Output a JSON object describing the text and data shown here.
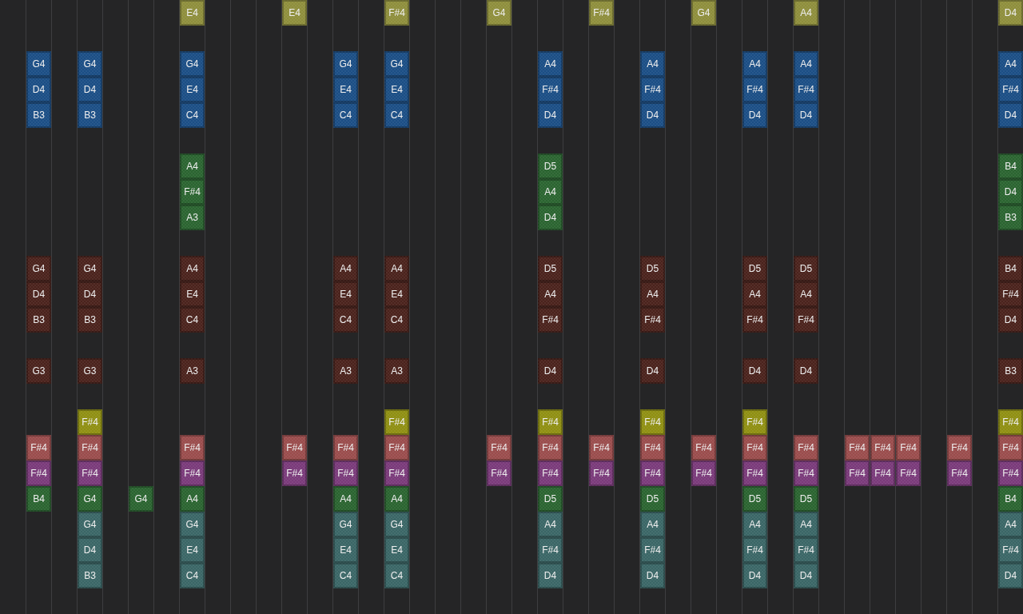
{
  "lanes": [
    {
      "color": "#8e8e3c",
      "cells": [
        null,
        null,
        null,
        null,
        null,
        null,
        null,
        "E4",
        null,
        null,
        null,
        "E4",
        null,
        null,
        null,
        "F#4",
        null,
        null,
        null,
        "G4",
        null,
        null,
        null,
        "F#4",
        null,
        null,
        null,
        "G4",
        null,
        null,
        null,
        "A4",
        null,
        null,
        null,
        null,
        null,
        null,
        null,
        "D4"
      ]
    },
    {
      "kind": "gap"
    },
    {
      "color": "#1b4e85",
      "cells": [
        null,
        "G4",
        null,
        "G4",
        null,
        null,
        null,
        "G4",
        null,
        null,
        null,
        null,
        null,
        "G4",
        null,
        "G4",
        null,
        null,
        null,
        null,
        null,
        "A4",
        null,
        null,
        null,
        "A4",
        null,
        null,
        null,
        "A4",
        null,
        "A4",
        null,
        null,
        null,
        null,
        null,
        null,
        null,
        "A4"
      ]
    },
    {
      "color": "#1b4e85",
      "cells": [
        null,
        "D4",
        null,
        "D4",
        null,
        null,
        null,
        "E4",
        null,
        null,
        null,
        null,
        null,
        "E4",
        null,
        "E4",
        null,
        null,
        null,
        null,
        null,
        "F#4",
        null,
        null,
        null,
        "F#4",
        null,
        null,
        null,
        "F#4",
        null,
        "F#4",
        null,
        null,
        null,
        null,
        null,
        null,
        null,
        "F#4"
      ]
    },
    {
      "color": "#1b4e85",
      "cells": [
        null,
        "B3",
        null,
        "B3",
        null,
        null,
        null,
        "C4",
        null,
        null,
        null,
        null,
        null,
        "C4",
        null,
        "C4",
        null,
        null,
        null,
        null,
        null,
        "D4",
        null,
        null,
        null,
        "D4",
        null,
        null,
        null,
        "D4",
        null,
        "D4",
        null,
        null,
        null,
        null,
        null,
        null,
        null,
        "D4"
      ]
    },
    {
      "kind": "gap"
    },
    {
      "color": "#2a6430",
      "cells": [
        null,
        null,
        null,
        null,
        null,
        null,
        null,
        "A4",
        null,
        null,
        null,
        null,
        null,
        null,
        null,
        null,
        null,
        null,
        null,
        null,
        null,
        "D5",
        null,
        null,
        null,
        null,
        null,
        null,
        null,
        null,
        null,
        null,
        null,
        null,
        null,
        null,
        null,
        null,
        null,
        "B4"
      ]
    },
    {
      "color": "#2a6430",
      "cells": [
        null,
        null,
        null,
        null,
        null,
        null,
        null,
        "F#4",
        null,
        null,
        null,
        null,
        null,
        null,
        null,
        null,
        null,
        null,
        null,
        null,
        null,
        "A4",
        null,
        null,
        null,
        null,
        null,
        null,
        null,
        null,
        null,
        null,
        null,
        null,
        null,
        null,
        null,
        null,
        null,
        "D4"
      ]
    },
    {
      "color": "#2a6430",
      "cells": [
        null,
        null,
        null,
        null,
        null,
        null,
        null,
        "A3",
        null,
        null,
        null,
        null,
        null,
        null,
        null,
        null,
        null,
        null,
        null,
        null,
        null,
        "D4",
        null,
        null,
        null,
        null,
        null,
        null,
        null,
        null,
        null,
        null,
        null,
        null,
        null,
        null,
        null,
        null,
        null,
        "B3"
      ]
    },
    {
      "kind": "gap"
    },
    {
      "color": "#4a221c",
      "cells": [
        null,
        "G4",
        null,
        "G4",
        null,
        null,
        null,
        "A4",
        null,
        null,
        null,
        null,
        null,
        "A4",
        null,
        "A4",
        null,
        null,
        null,
        null,
        null,
        "D5",
        null,
        null,
        null,
        "D5",
        null,
        null,
        null,
        "D5",
        null,
        "D5",
        null,
        null,
        null,
        null,
        null,
        null,
        null,
        "B4"
      ]
    },
    {
      "color": "#4a221c",
      "cells": [
        null,
        "D4",
        null,
        "D4",
        null,
        null,
        null,
        "E4",
        null,
        null,
        null,
        null,
        null,
        "E4",
        null,
        "E4",
        null,
        null,
        null,
        null,
        null,
        "A4",
        null,
        null,
        null,
        "A4",
        null,
        null,
        null,
        "A4",
        null,
        "A4",
        null,
        null,
        null,
        null,
        null,
        null,
        null,
        "F#4"
      ]
    },
    {
      "color": "#4a221c",
      "cells": [
        null,
        "B3",
        null,
        "B3",
        null,
        null,
        null,
        "C4",
        null,
        null,
        null,
        null,
        null,
        "C4",
        null,
        "C4",
        null,
        null,
        null,
        null,
        null,
        "F#4",
        null,
        null,
        null,
        "F#4",
        null,
        null,
        null,
        "F#4",
        null,
        "F#4",
        null,
        null,
        null,
        null,
        null,
        null,
        null,
        "D4"
      ]
    },
    {
      "kind": "gap"
    },
    {
      "color": "#4a221c",
      "cells": [
        null,
        "G3",
        null,
        "G3",
        null,
        null,
        null,
        "A3",
        null,
        null,
        null,
        null,
        null,
        "A3",
        null,
        "A3",
        null,
        null,
        null,
        null,
        null,
        "D4",
        null,
        null,
        null,
        "D4",
        null,
        null,
        null,
        "D4",
        null,
        "D4",
        null,
        null,
        null,
        null,
        null,
        null,
        null,
        "B3"
      ]
    },
    {
      "kind": "gap"
    },
    {
      "color": "#8f8f12",
      "cells": [
        null,
        null,
        null,
        "F#4",
        null,
        null,
        null,
        null,
        null,
        null,
        null,
        null,
        null,
        null,
        null,
        "F#4",
        null,
        null,
        null,
        null,
        null,
        "F#4",
        null,
        null,
        null,
        "F#4",
        null,
        null,
        null,
        "F#4",
        null,
        null,
        null,
        null,
        null,
        null,
        null,
        null,
        null,
        "F#4"
      ]
    },
    {
      "color": "#9a4c4c",
      "cells": [
        null,
        "F#4",
        null,
        "F#4",
        null,
        null,
        null,
        "F#4",
        null,
        null,
        null,
        "F#4",
        null,
        "F#4",
        null,
        "F#4",
        null,
        null,
        null,
        "F#4",
        null,
        "F#4",
        null,
        "F#4",
        null,
        "F#4",
        null,
        "F#4",
        null,
        "F#4",
        null,
        "F#4",
        null,
        "F#4",
        "F#4",
        "F#4",
        null,
        "F#4",
        null,
        "F#4"
      ]
    },
    {
      "color": "#7a3a7a",
      "cells": [
        null,
        "F#4",
        null,
        "F#4",
        null,
        null,
        null,
        "F#4",
        null,
        null,
        null,
        "F#4",
        null,
        "F#4",
        null,
        "F#4",
        null,
        null,
        null,
        "F#4",
        null,
        "F#4",
        null,
        "F#4",
        null,
        "F#4",
        null,
        "F#4",
        null,
        "F#4",
        null,
        "F#4",
        null,
        "F#4",
        "F#4",
        "F#4",
        null,
        "F#4",
        null,
        "F#4"
      ]
    },
    {
      "color": "#2a6430",
      "cells": [
        null,
        "B4",
        null,
        "G4",
        null,
        "G4",
        null,
        "A4",
        null,
        null,
        null,
        null,
        null,
        "A4",
        null,
        "A4",
        null,
        null,
        null,
        null,
        null,
        "D5",
        null,
        null,
        null,
        "D5",
        null,
        null,
        null,
        "D5",
        null,
        "D5",
        null,
        null,
        null,
        null,
        null,
        null,
        null,
        "B4"
      ]
    },
    {
      "color": "#3a6666",
      "cells": [
        null,
        null,
        null,
        "G4",
        null,
        null,
        null,
        "G4",
        null,
        null,
        null,
        null,
        null,
        "G4",
        null,
        "G4",
        null,
        null,
        null,
        null,
        null,
        "A4",
        null,
        null,
        null,
        "A4",
        null,
        null,
        null,
        "A4",
        null,
        "A4",
        null,
        null,
        null,
        null,
        null,
        null,
        null,
        "A4"
      ]
    },
    {
      "color": "#3a6666",
      "cells": [
        null,
        null,
        null,
        "D4",
        null,
        null,
        null,
        "E4",
        null,
        null,
        null,
        null,
        null,
        "E4",
        null,
        "E4",
        null,
        null,
        null,
        null,
        null,
        "F#4",
        null,
        null,
        null,
        "F#4",
        null,
        null,
        null,
        "F#4",
        null,
        "F#4",
        null,
        null,
        null,
        null,
        null,
        null,
        null,
        "F#4"
      ]
    },
    {
      "color": "#3a6666",
      "cells": [
        null,
        null,
        null,
        "B3",
        null,
        null,
        null,
        "C4",
        null,
        null,
        null,
        null,
        null,
        "C4",
        null,
        "C4",
        null,
        null,
        null,
        null,
        null,
        "D4",
        null,
        null,
        null,
        "D4",
        null,
        null,
        null,
        "D4",
        null,
        "D4",
        null,
        null,
        null,
        null,
        null,
        null,
        null,
        "D4"
      ]
    },
    {
      "kind": "gap"
    }
  ]
}
